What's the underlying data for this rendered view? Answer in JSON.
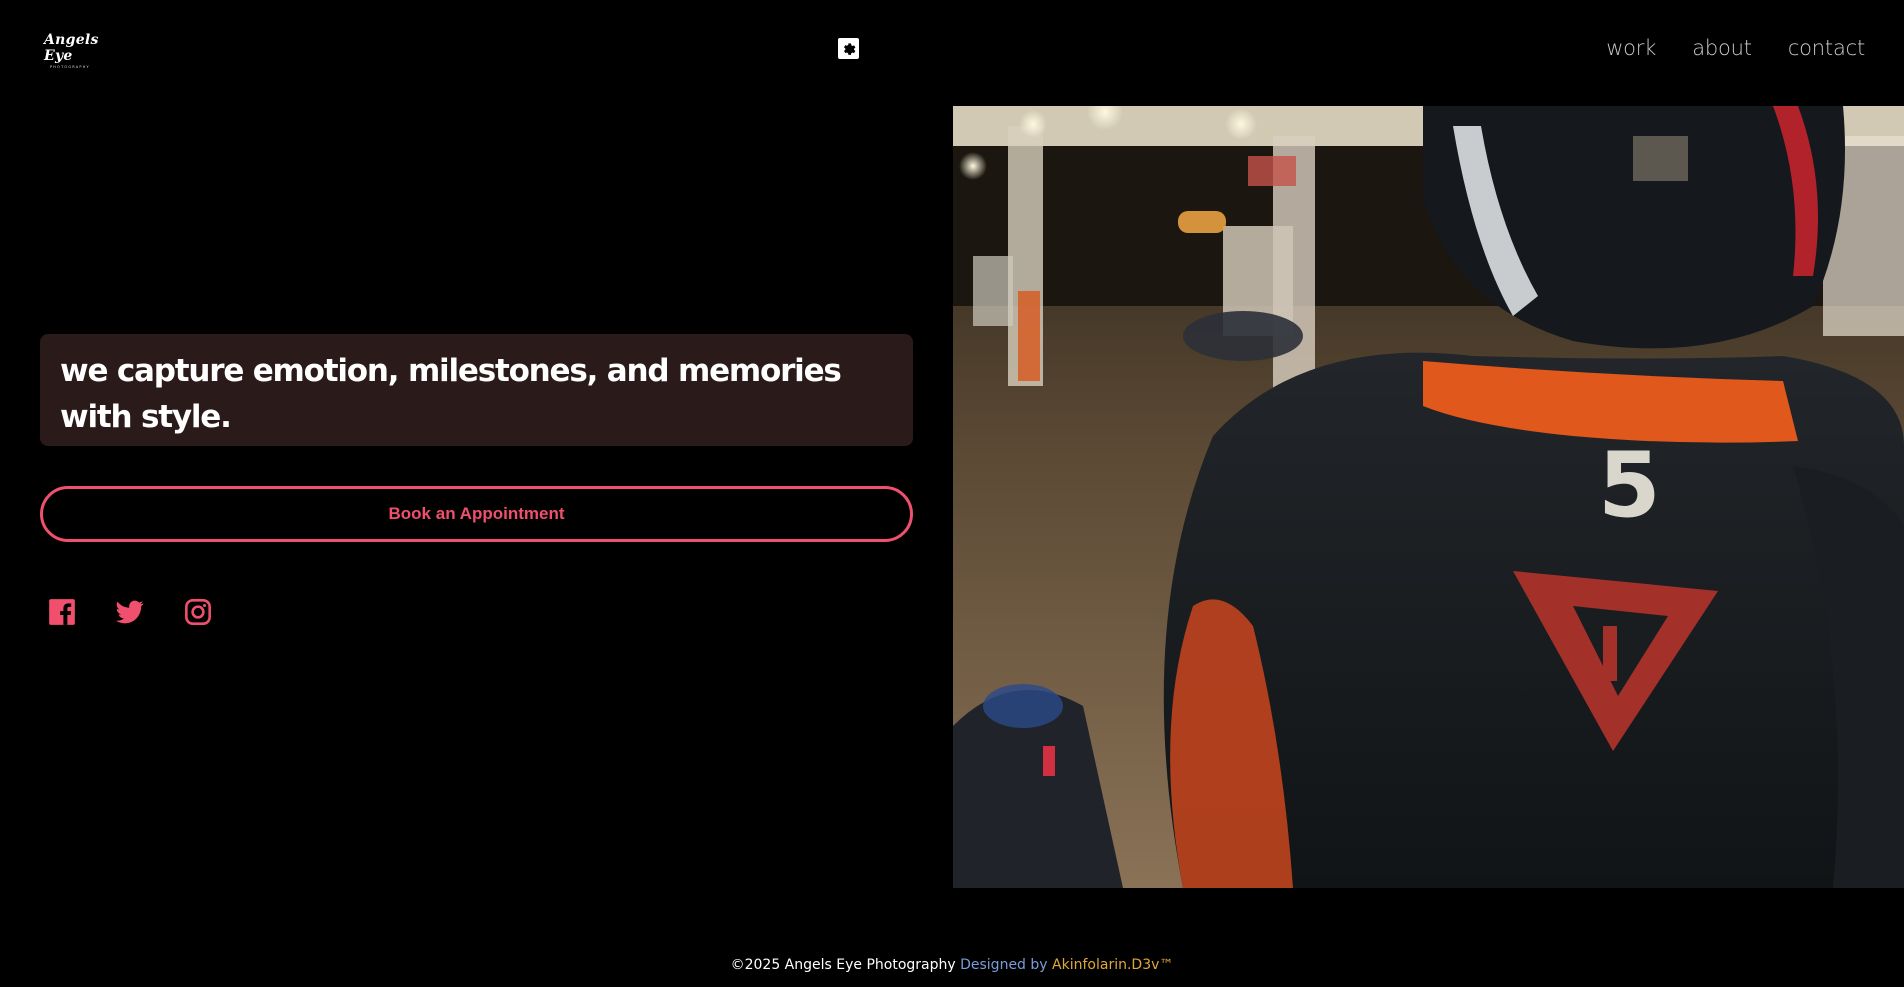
{
  "header": {
    "logo_main": "Angels Eye",
    "logo_sub": "PHOTOGRAPHY",
    "theme_toggle_icon": "gear-icon",
    "nav": [
      {
        "label": "work"
      },
      {
        "label": "about"
      },
      {
        "label": "contact"
      }
    ]
  },
  "hero": {
    "tagline": "we capture emotion, milestones, and memories with style.",
    "cta_label": "Book an Appointment",
    "socials": [
      {
        "icon": "facebook-icon"
      },
      {
        "icon": "twitter-icon"
      },
      {
        "icon": "instagram-icon"
      }
    ],
    "image_number": "5"
  },
  "footer": {
    "copyright": "©2025 Angels Eye Photography",
    "designed_by": "Designed by",
    "author": "Akinfolarin.D3v™"
  },
  "colors": {
    "background": "#000000",
    "accent": "#f0506e",
    "tagline_bg": "#2b1a1a",
    "designed_by": "#7b9cd8",
    "author": "#e0a83a"
  }
}
